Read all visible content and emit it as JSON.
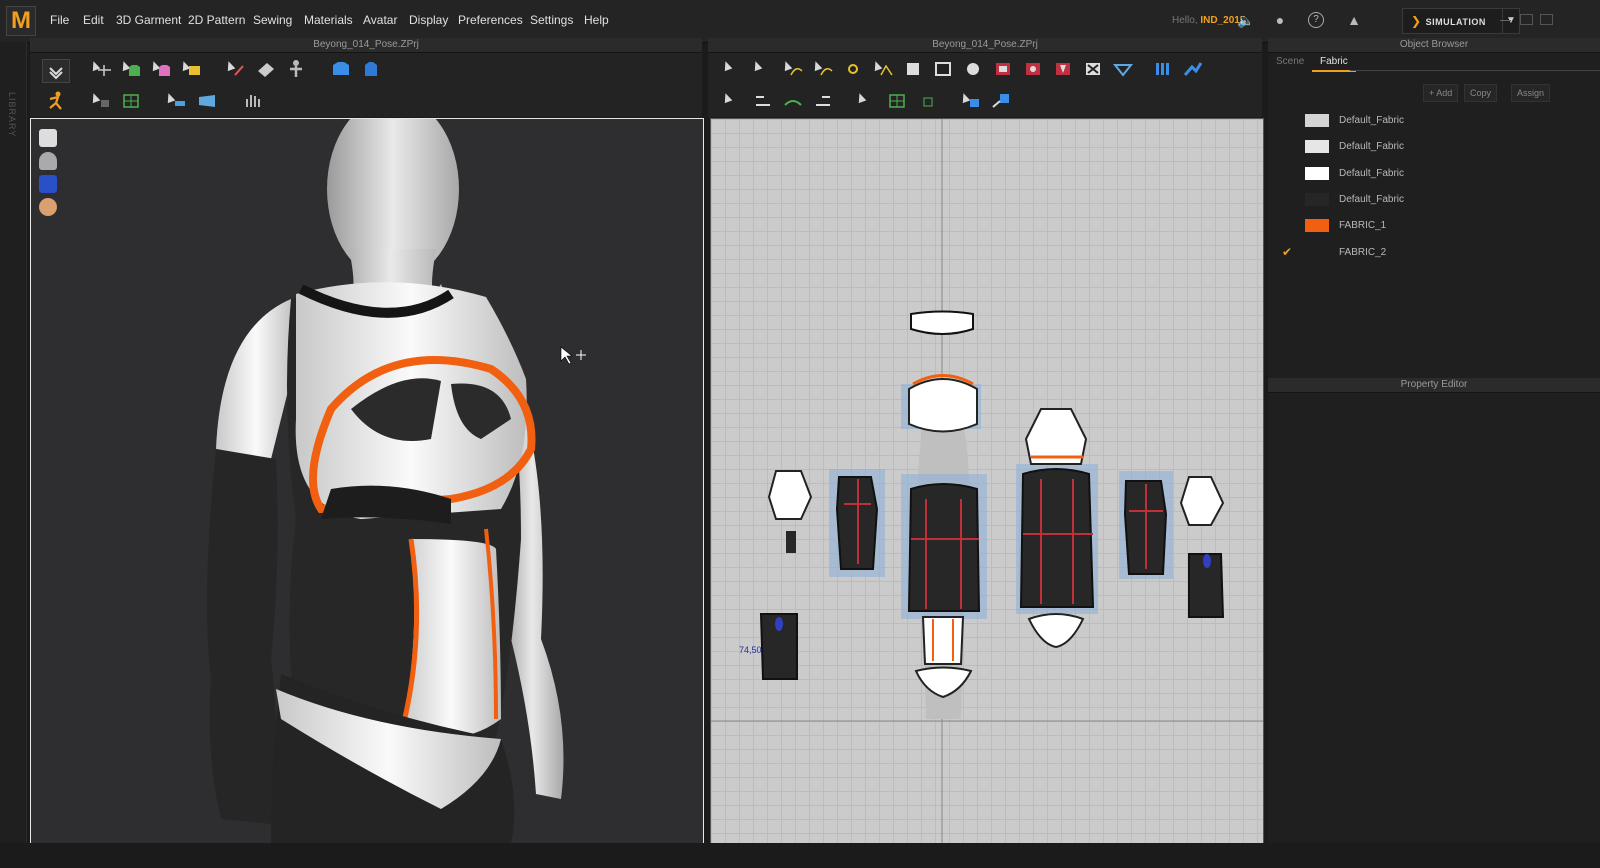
{
  "app": {
    "logo_letter": "M",
    "accent": "#f0a020"
  },
  "menu": [
    "File",
    "Edit",
    "3D Garment",
    "2D Pattern",
    "Sewing",
    "Materials",
    "Avatar",
    "Display",
    "Preferences",
    "Settings",
    "Help"
  ],
  "user": {
    "greeting": "Hello,",
    "name": "IND_2015"
  },
  "topbar": {
    "simulation_label": "SIMULATION"
  },
  "library_label": "LIBRARY",
  "view3d": {
    "title": "Beyong_014_Pose.ZPrj"
  },
  "view2d": {
    "title": "Beyong_014_Pose.ZPrj",
    "measure_label": "74,50"
  },
  "object_browser": {
    "title": "Object Browser",
    "tabs": [
      "Scene",
      "Fabric"
    ],
    "active_tab": "Fabric",
    "buttons": [
      "+ Add",
      "Copy",
      "Assign"
    ],
    "fabrics": [
      {
        "name": "Default_Fabric",
        "color": "#d4d4d4",
        "checked": false
      },
      {
        "name": "Default_Fabric",
        "color": "#e6e6e6",
        "checked": false
      },
      {
        "name": "Default_Fabric",
        "color": "#ffffff",
        "checked": false
      },
      {
        "name": "Default_Fabric",
        "color": "#262626",
        "checked": false
      },
      {
        "name": "FABRIC_1",
        "color": "#f06010",
        "checked": false
      },
      {
        "name": "FABRIC_2",
        "color": "#1f1f1f",
        "checked": true
      }
    ]
  },
  "property_editor": {
    "title": "Property Editor"
  }
}
